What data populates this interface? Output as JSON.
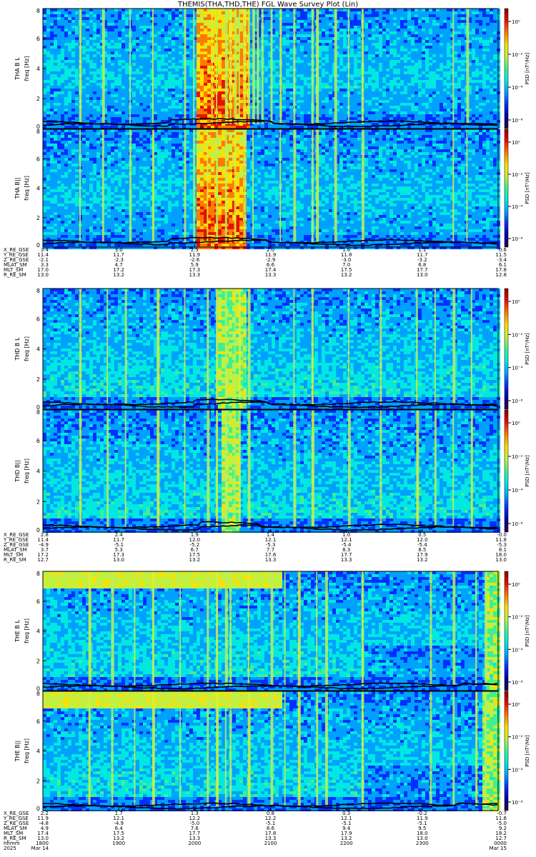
{
  "title": "THEMIS(THA,THD,THE) FGL Wave Survey Plot (Lin)",
  "colors": {
    "background": "#ffffff",
    "text": "#000000",
    "trace": "#000000",
    "colormap": [
      "#2a0040",
      "#0000a0",
      "#0030ff",
      "#00a0ff",
      "#00e8e0",
      "#40f090",
      "#c0f040",
      "#ffe000",
      "#ff7a00",
      "#e81000",
      "#8a0000"
    ]
  },
  "chart_data": [
    {
      "type": "heatmap",
      "ylabel": "THA B L",
      "yunit": "freq [Hz]",
      "ylim": [
        0,
        8
      ],
      "yticks": [
        "0",
        "2",
        "4",
        "6",
        "8"
      ],
      "colorbar": {
        "label": "PSD [nT²/Hz]",
        "ticks": [
          "10⁰",
          "10⁻²",
          "10⁻⁴",
          "10⁻⁶"
        ]
      },
      "bright_bands_x": [
        0.08,
        0.13,
        0.19,
        0.24,
        0.31,
        0.33,
        0.37,
        0.38,
        0.4,
        0.41,
        0.42,
        0.43,
        0.44,
        0.45,
        0.46,
        0.47,
        0.48,
        0.5,
        0.52,
        0.55,
        0.59,
        0.6,
        0.64,
        0.67,
        0.7,
        0.9,
        0.93
      ],
      "intense_range_x": [
        0.33,
        0.45
      ]
    },
    {
      "type": "heatmap",
      "ylabel": "THA B||",
      "yunit": "freq [Hz]",
      "ylim": [
        0,
        8
      ],
      "yticks": [
        "0",
        "2",
        "4",
        "6",
        "8"
      ],
      "colorbar": {
        "label": "PSD [nT²/Hz]",
        "ticks": [
          "10⁰",
          "10⁻²",
          "10⁻⁴",
          "10⁻⁶"
        ]
      },
      "bright_bands_x": [
        0.08,
        0.13,
        0.19,
        0.24,
        0.31,
        0.33,
        0.36,
        0.38,
        0.4,
        0.42,
        0.44,
        0.46,
        0.52,
        0.55,
        0.59,
        0.6,
        0.64,
        0.7,
        0.9,
        0.93
      ],
      "intense_range_x": [
        0.33,
        0.44
      ]
    },
    {
      "type": "heatmap",
      "ylabel": "THD B L",
      "yunit": "freq [Hz]",
      "ylim": [
        0,
        8
      ],
      "yticks": [
        "0",
        "2",
        "4",
        "6",
        "8"
      ],
      "colorbar": {
        "label": "PSD [nT²/Hz]",
        "ticks": [
          "10⁰",
          "10⁻²",
          "10⁻⁴",
          "10⁻⁶"
        ]
      },
      "bright_bands_x": [
        0.08,
        0.14,
        0.18,
        0.25,
        0.31,
        0.36,
        0.38,
        0.4,
        0.42,
        0.43,
        0.45,
        0.55,
        0.59,
        0.67,
        0.74,
        0.82,
        0.86,
        0.9,
        0.94
      ],
      "intense_range_x": [
        0.38,
        0.44
      ]
    },
    {
      "type": "heatmap",
      "ylabel": "THD B||",
      "yunit": "freq [Hz]",
      "ylim": [
        0,
        8
      ],
      "yticks": [
        "0",
        "2",
        "4",
        "6",
        "8"
      ],
      "colorbar": {
        "label": "PSD [nT²/Hz]",
        "ticks": [
          "10⁰",
          "10⁻²",
          "10⁻⁴",
          "10⁻⁶"
        ]
      },
      "bright_bands_x": [
        0.08,
        0.14,
        0.18,
        0.25,
        0.31,
        0.36,
        0.38,
        0.4,
        0.42,
        0.43,
        0.45,
        0.55,
        0.59,
        0.67,
        0.74,
        0.82,
        0.86,
        0.9,
        0.94
      ],
      "intense_range_x": [
        0.39,
        0.43
      ]
    },
    {
      "type": "heatmap",
      "ylabel": "THE B L",
      "yunit": "freq [Hz]",
      "ylim": [
        0,
        8
      ],
      "yticks": [
        "0",
        "2",
        "4",
        "6",
        "8"
      ],
      "colorbar": {
        "label": "PSD [nT²/Hz]",
        "ticks": [
          "10⁰",
          "10⁻²",
          "10⁻⁴",
          "10⁻⁶"
        ]
      },
      "bright_bands_x": [
        0.1,
        0.15,
        0.2,
        0.24,
        0.3,
        0.36,
        0.38,
        0.4,
        0.41,
        0.45,
        0.5,
        0.53,
        0.56,
        0.6,
        0.62,
        0.7,
        0.85,
        0.9,
        0.95,
        0.97
      ],
      "intense_range_x": [
        0.97,
        1.0
      ],
      "upper_band_end_x": 0.52
    },
    {
      "type": "heatmap",
      "ylabel": "THE B||",
      "yunit": "freq [Hz]",
      "ylim": [
        0,
        8
      ],
      "yticks": [
        "0",
        "2",
        "4",
        "6",
        "8"
      ],
      "colorbar": {
        "label": "PSD [nT²/Hz]",
        "ticks": [
          "10⁰",
          "10⁻²",
          "10⁻⁴",
          "10⁻⁶"
        ]
      },
      "bright_bands_x": [
        0.1,
        0.15,
        0.2,
        0.24,
        0.3,
        0.36,
        0.38,
        0.4,
        0.41,
        0.45,
        0.5,
        0.53,
        0.56,
        0.6,
        0.62,
        0.7,
        0.85,
        0.9,
        0.95,
        0.97
      ],
      "intense_range_x": [
        0.96,
        1.0
      ],
      "upper_band_end_x": 0.52
    }
  ],
  "ephemeris": [
    {
      "labels": [
        "X_RE_GSE",
        "Y_RE_GSE",
        "Z_RE_GSE",
        "MLAT_SM",
        "MLT_SM",
        "R_RE_SM"
      ],
      "columns": [
        [
          "3.4",
          "11.4",
          "-2.1",
          "3.3",
          "17.0",
          "13.0"
        ],
        [
          "3.0",
          "11.7",
          "-2.3",
          "4.7",
          "17.2",
          "13.2"
        ],
        [
          "2.5",
          "11.9",
          "-2.6",
          "5.9",
          "17.3",
          "13.3"
        ],
        [
          "2.0",
          "11.9",
          "-2.9",
          "6.6",
          "17.4",
          "13.3"
        ],
        [
          "1.6",
          "11.8",
          "-3.0",
          "7.0",
          "17.5",
          "13.2"
        ],
        [
          "1.1",
          "11.7",
          "-3.2",
          "6.8",
          "17.7",
          "13.0"
        ],
        [
          "0.6",
          "11.5",
          "-3.4",
          "6.1",
          "17.8",
          "12.8"
        ]
      ]
    },
    {
      "labels": [
        "X_RE_GSE",
        "Y_RE_GSE",
        "Z_RE_GSE",
        "MLAT_SM",
        "MLT_SM",
        "R_RE_SM"
      ],
      "columns": [
        [
          "2.8",
          "11.4",
          "-4.9",
          "3.7",
          "17.2",
          "12.7"
        ],
        [
          "2.4",
          "11.7",
          "-5.1",
          "5.3",
          "17.3",
          "13.0"
        ],
        [
          "1.9",
          "12.0",
          "-5.2",
          "6.7",
          "17.5",
          "13.2"
        ],
        [
          "1.4",
          "12.1",
          "-5.3",
          "7.7",
          "17.6",
          "13.3"
        ],
        [
          "1.0",
          "12.1",
          "-5.4",
          "8.3",
          "17.7",
          "13.3"
        ],
        [
          "0.5",
          "12.0",
          "-5.4",
          "8.5",
          "17.9",
          "13.2"
        ],
        [
          "-0.0",
          "11.8",
          "-5.3",
          "8.1",
          "18.0",
          "13.0"
        ]
      ]
    },
    {
      "labels": [
        "X_RE_GSE",
        "Y_RE_GSE",
        "Z_RE_GSE",
        "MLAT_SM",
        "MLT_SM",
        "R_RE_SM",
        "hhmm",
        "2025"
      ],
      "columns": [
        [
          "2.2",
          "11.9",
          "-4.8",
          "4.9",
          "17.4",
          "13.0",
          "1800",
          "Mar 14"
        ],
        [
          "1.7",
          "12.1",
          "-4.9",
          "6.4",
          "17.5",
          "13.2",
          "1900",
          ""
        ],
        [
          "1.3",
          "12.2",
          "-5.0",
          "7.6",
          "17.7",
          "13.3",
          "2000",
          ""
        ],
        [
          "0.8",
          "12.2",
          "-5.1",
          "8.6",
          "17.8",
          "13.3",
          "2100",
          ""
        ],
        [
          "0.3",
          "12.1",
          "-5.1",
          "9.4",
          "17.9",
          "13.2",
          "2200",
          ""
        ],
        [
          "-0.2",
          "11.9",
          "-5.1",
          "9.5",
          "18.0",
          "13.0",
          "2300",
          ""
        ],
        [
          "-0.7",
          "11.6",
          "-5.0",
          "9.2",
          "18.2",
          "12.7",
          "0000",
          "Mar 15"
        ]
      ]
    }
  ]
}
